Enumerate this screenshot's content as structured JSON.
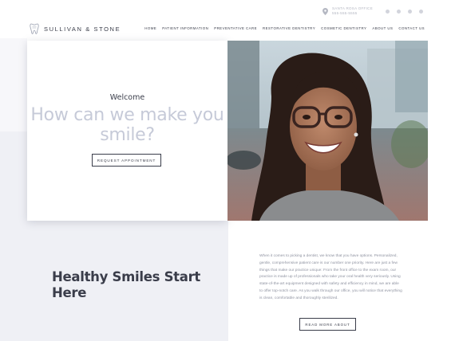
{
  "topbar": {
    "office_name": "SANTA ROSA OFFICE",
    "office_phone": "555-555-5555",
    "social_icons": [
      "facebook-icon",
      "instagram-icon",
      "yelp-icon",
      "google-icon"
    ]
  },
  "brand": {
    "name": "SULLIVAN & STONE",
    "logo_icon": "tooth-icon"
  },
  "nav": {
    "items": [
      "HOME",
      "PATIENT INFORMATION",
      "PREVENTATIVE CARE",
      "RESTORATIVE DENTISTRY",
      "COSMETIC DENTISTRY",
      "ABOUT US",
      "CONTACT US"
    ]
  },
  "hero": {
    "welcome": "Welcome",
    "title": "How can we make you smile?",
    "button_label": "REQUEST APPOINTMENT"
  },
  "intro": {
    "heading": "Healthy Smiles Start Here",
    "paragraph": "When it comes to picking a dentist, we know that you have options. Personalized, gentle, comprehensive patient care is our number one priority. Here are just a few things that make our practice unique: From the front office to the exam room, our practice is made up of professionals who take your oral health very seriously. Using state-of-the-art equipment designed with safety and efficiency in mind, we are able to offer top-notch care. As you walk through our office, you will notice that everything is clean, comfortable and thoroughly sterilized.",
    "button_label": "READ MORE ABOUT"
  },
  "colors": {
    "text_dark": "#3a3d4a",
    "hero_title": "#c6cad8",
    "section_bg": "#eff0f5",
    "body_text": "#8f93a1"
  }
}
